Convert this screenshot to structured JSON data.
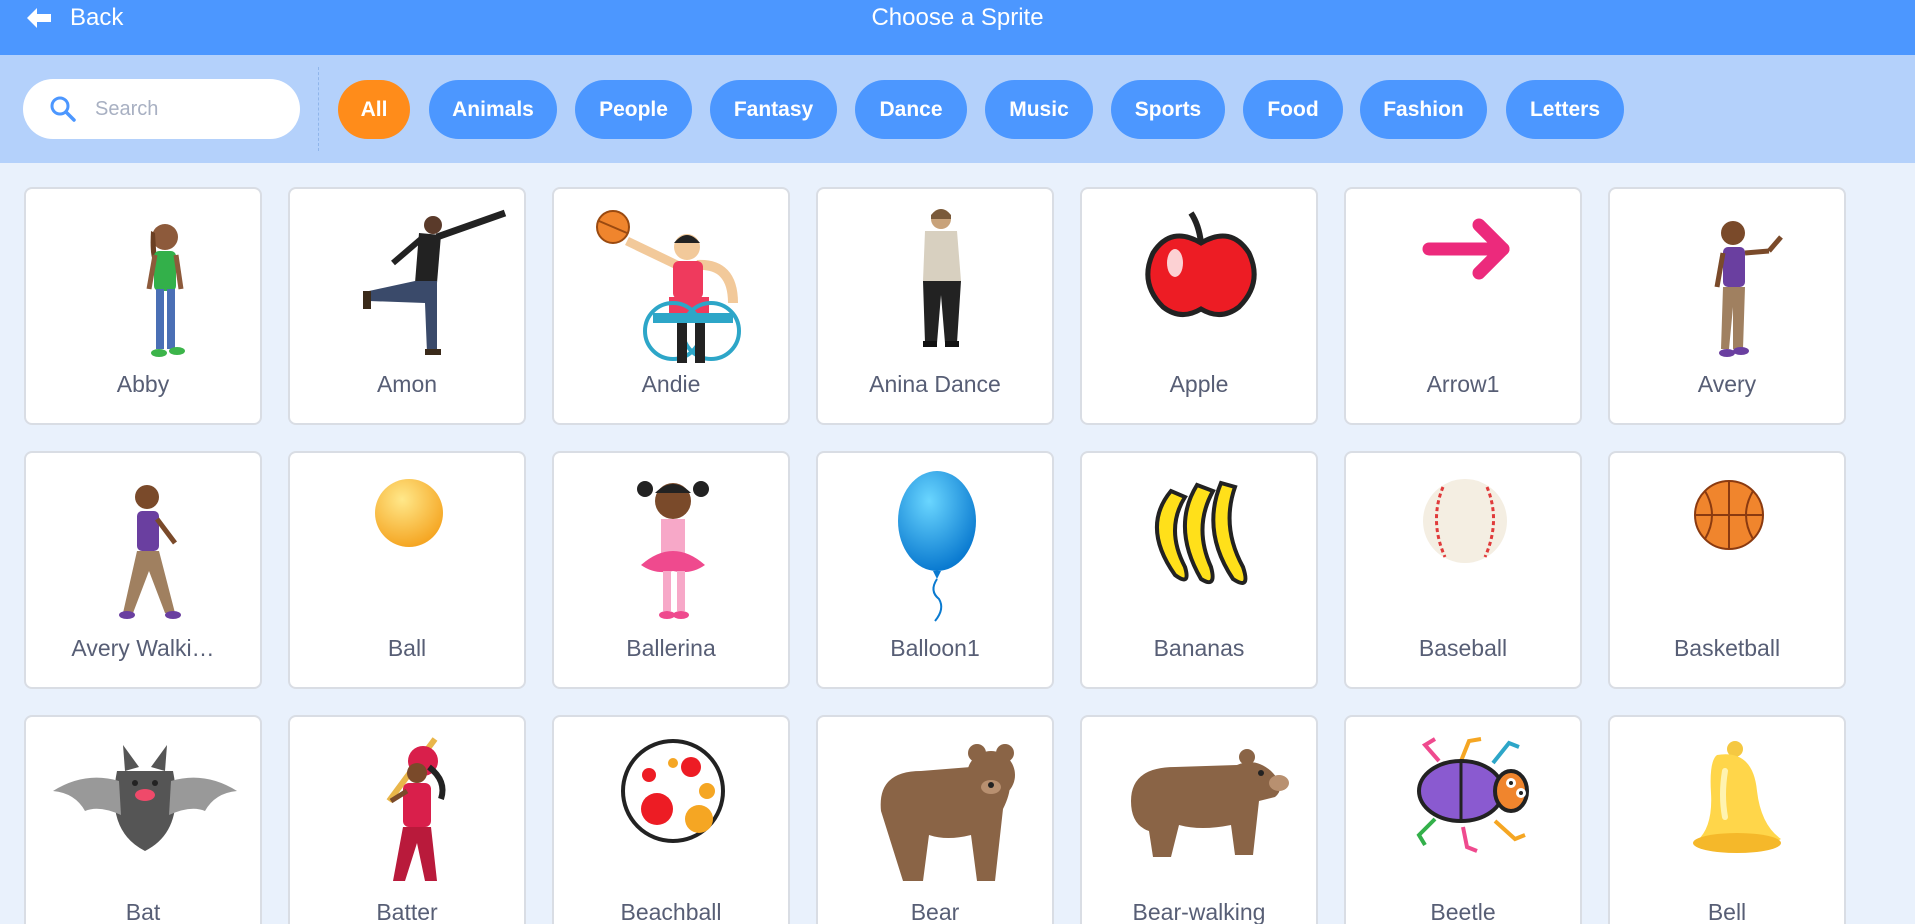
{
  "header": {
    "back_label": "Back",
    "title": "Choose a Sprite"
  },
  "search": {
    "placeholder": "Search",
    "value": ""
  },
  "filters": [
    {
      "label": "All",
      "active": true
    },
    {
      "label": "Animals",
      "active": false
    },
    {
      "label": "People",
      "active": false
    },
    {
      "label": "Fantasy",
      "active": false
    },
    {
      "label": "Dance",
      "active": false
    },
    {
      "label": "Music",
      "active": false
    },
    {
      "label": "Sports",
      "active": false
    },
    {
      "label": "Food",
      "active": false
    },
    {
      "label": "Fashion",
      "active": false
    },
    {
      "label": "Letters",
      "active": false
    }
  ],
  "sprites": [
    {
      "name": "Abby",
      "icon": "girl-standing-icon"
    },
    {
      "name": "Amon",
      "icon": "man-dancing-icon"
    },
    {
      "name": "Andie",
      "icon": "wheelchair-basketball-player-icon"
    },
    {
      "name": "Anina Dance",
      "icon": "woman-dancing-icon"
    },
    {
      "name": "Apple",
      "icon": "apple-icon"
    },
    {
      "name": "Arrow1",
      "icon": "arrow-right-icon"
    },
    {
      "name": "Avery",
      "icon": "girl-waving-icon"
    },
    {
      "name": "Avery Walki…",
      "icon": "girl-walking-icon"
    },
    {
      "name": "Ball",
      "icon": "ball-icon"
    },
    {
      "name": "Ballerina",
      "icon": "ballerina-icon"
    },
    {
      "name": "Balloon1",
      "icon": "balloon-icon"
    },
    {
      "name": "Bananas",
      "icon": "bananas-icon"
    },
    {
      "name": "Baseball",
      "icon": "baseball-icon"
    },
    {
      "name": "Basketball",
      "icon": "basketball-icon"
    },
    {
      "name": "Bat",
      "icon": "bat-icon"
    },
    {
      "name": "Batter",
      "icon": "baseball-batter-icon"
    },
    {
      "name": "Beachball",
      "icon": "beachball-icon"
    },
    {
      "name": "Bear",
      "icon": "bear-icon"
    },
    {
      "name": "Bear-walking",
      "icon": "bear-walking-icon"
    },
    {
      "name": "Beetle",
      "icon": "beetle-icon"
    },
    {
      "name": "Bell",
      "icon": "bell-icon"
    }
  ],
  "colors": {
    "header_bg": "#4c97ff",
    "filterbar_bg": "#b4d1fb",
    "active_pill": "#ff8c1a",
    "page_bg": "#e9f1fc",
    "label_text": "#575e75"
  }
}
